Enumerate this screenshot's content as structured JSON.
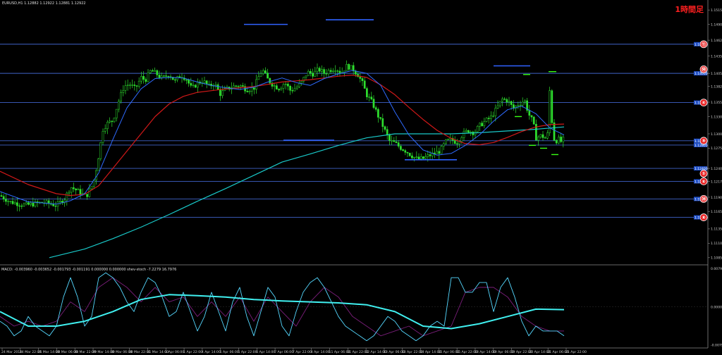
{
  "window": {
    "symbol_header": "EURUSD,H1  1.12882 1.12922 1.12881 1.12922",
    "timeframe_label": "1時間足",
    "macd_header": "MACD: -0.003960 -0.003652 -0.001793 -0.001191 0.000000 0.000000 shev-stoch -7.2279 16.7976"
  },
  "colors": {
    "background": "#000000",
    "grid": "#1f1f1f",
    "candle": "#2ee02e",
    "fast_ma": "#2f6bff",
    "mid_ma": "#d01818",
    "slow_ma": "#19c9c9",
    "hline": "#3f63c8",
    "horizontal_segment": "#2f62ff",
    "marker_segment": "#39ff14",
    "number_badge": "#e82020",
    "macd_fast": "#55d8ff",
    "macd_slow": "#7a1e7a",
    "macd_smooth": "#40f0f0"
  },
  "chart_data": [
    {
      "type": "line",
      "subtype": "candlestick",
      "symbol": "EURUSD",
      "timeframe": "H1",
      "y_tick_labels": [
        "1.15150",
        "1.14900",
        "1.14625",
        "1.14350",
        "1.14050",
        "1.13825",
        "1.13550",
        "1.13300",
        "1.13000",
        "1.12750",
        "1.12400",
        "1.12175",
        "1.11900",
        "1.11650",
        "1.11350",
        "1.11100",
        "1.10850"
      ],
      "y_tick_values": [
        1.1515,
        1.149,
        1.14625,
        1.1435,
        1.1405,
        1.13825,
        1.1355,
        1.133,
        1.13,
        1.1275,
        1.124,
        1.12175,
        1.119,
        1.1165,
        1.1135,
        1.111,
        1.1085
      ],
      "ylim": [
        1.1075,
        1.1525
      ],
      "x_tick_labels": [
        "24 Mar 2016",
        "24 Mar 22:00",
        "25 Mar 14:00",
        "28 Mar 06:00",
        "28 Mar 22:00",
        "29 Mar 14:00",
        "30 Mar 06:00",
        "30 Mar 22:00",
        "31 Mar 14:00",
        "1 Apr 06:00",
        "1 Apr 22:00",
        "4 Apr 14:00",
        "5 Apr 06:00",
        "5 Apr 22:00",
        "6 Apr 14:00",
        "7 Apr 06:00",
        "7 Apr 22:00",
        "8 Apr 14:00",
        "11 Apr 06:00",
        "11 Apr 22:00",
        "12 Apr 14:00",
        "13 Apr 06:00",
        "13 Apr 22:00",
        "14 Apr 14:00",
        "15 Apr 06:00",
        "15 Apr 22:00",
        "18 Apr 14:00",
        "19 Apr 06:00",
        "19 Apr 22:00",
        "20 Apr 14:00",
        "21 Apr 06:00",
        "21 Apr 22:00"
      ],
      "price_path_x": [
        0,
        14,
        36,
        62,
        80,
        92,
        100,
        110,
        122,
        132,
        138,
        146,
        152,
        160,
        168,
        176,
        184,
        192,
        200,
        206,
        214,
        222,
        230,
        240,
        248,
        256,
        264,
        272,
        280,
        288,
        296,
        304,
        312,
        320,
        330,
        340,
        350,
        360,
        366,
        372,
        380,
        388,
        396,
        404,
        412,
        420,
        428,
        436,
        444,
        452,
        460,
        468,
        476,
        484,
        492,
        500,
        508,
        514,
        520,
        528,
        536,
        544,
        552,
        560,
        568,
        576,
        584,
        592,
        600,
        608,
        616,
        624,
        632,
        640,
        648,
        656,
        664,
        672,
        680,
        688,
        696,
        704,
        712,
        720,
        728,
        736,
        744,
        750,
        756,
        760,
        768,
        776,
        780,
        784,
        788,
        792,
        796,
        800
      ],
      "price_path_y": [
        1.1193,
        1.1182,
        1.1176,
        1.1181,
        1.1176,
        1.1188,
        1.1208,
        1.1201,
        1.1191,
        1.1213,
        1.1248,
        1.1308,
        1.1318,
        1.1323,
        1.1356,
        1.1383,
        1.1386,
        1.1378,
        1.1398,
        1.1393,
        1.141,
        1.1404,
        1.1396,
        1.1404,
        1.1391,
        1.1402,
        1.1396,
        1.1378,
        1.1388,
        1.1392,
        1.1382,
        1.1388,
        1.1369,
        1.1377,
        1.1382,
        1.1384,
        1.1377,
        1.1379,
        1.1397,
        1.1411,
        1.1394,
        1.1384,
        1.1379,
        1.1389,
        1.1375,
        1.138,
        1.139,
        1.1407,
        1.1404,
        1.1412,
        1.1405,
        1.1411,
        1.1414,
        1.1406,
        1.1418,
        1.1413,
        1.1402,
        1.1388,
        1.1368,
        1.1354,
        1.1332,
        1.1311,
        1.1288,
        1.1284,
        1.1276,
        1.127,
        1.1262,
        1.1256,
        1.1257,
        1.1262,
        1.1266,
        1.127,
        1.1286,
        1.129,
        1.1285,
        1.1299,
        1.1306,
        1.1302,
        1.1314,
        1.1322,
        1.1328,
        1.1343,
        1.136,
        1.1358,
        1.1344,
        1.1352,
        1.1358,
        1.1334,
        1.1321,
        1.1293,
        1.1297,
        1.129,
        1.1384,
        1.1295,
        1.1287,
        1.1291,
        1.1286,
        1.1292
      ],
      "fast_ma": {
        "x": [
          0,
          40,
          80,
          100,
          120,
          140,
          160,
          180,
          200,
          220,
          240,
          260,
          280,
          300,
          320,
          340,
          360,
          380,
          400,
          420,
          440,
          460,
          480,
          500,
          520,
          540,
          560,
          580,
          600,
          620,
          640,
          660,
          680,
          700,
          720,
          740,
          760,
          780,
          800
        ],
        "y": [
          1.12,
          1.1182,
          1.1178,
          1.1184,
          1.1196,
          1.1232,
          1.129,
          1.1345,
          1.1378,
          1.1396,
          1.1398,
          1.1397,
          1.139,
          1.1384,
          1.138,
          1.1377,
          1.1381,
          1.139,
          1.1397,
          1.1389,
          1.1384,
          1.1396,
          1.1404,
          1.141,
          1.1405,
          1.1384,
          1.1338,
          1.1298,
          1.1272,
          1.1263,
          1.1266,
          1.128,
          1.1298,
          1.1322,
          1.1342,
          1.1348,
          1.1335,
          1.131,
          1.1298
        ]
      },
      "mid_ma": {
        "x": [
          0,
          40,
          80,
          100,
          120,
          140,
          160,
          180,
          200,
          220,
          240,
          260,
          280,
          300,
          320,
          340,
          360,
          380,
          400,
          420,
          440,
          460,
          480,
          500,
          520,
          540,
          560,
          580,
          600,
          620,
          640,
          660,
          680,
          700,
          720,
          740,
          760,
          780,
          800
        ],
        "y": [
          1.1235,
          1.1212,
          1.1196,
          1.1193,
          1.1195,
          1.121,
          1.124,
          1.127,
          1.13,
          1.133,
          1.1352,
          1.1365,
          1.1372,
          1.1375,
          1.1378,
          1.138,
          1.1382,
          1.1386,
          1.139,
          1.1392,
          1.1394,
          1.1397,
          1.14,
          1.1402,
          1.1398,
          1.1385,
          1.1368,
          1.1346,
          1.1325,
          1.1306,
          1.1292,
          1.1283,
          1.1281,
          1.1285,
          1.1294,
          1.1304,
          1.1312,
          1.1316,
          1.1317
        ]
      },
      "slow_ma": {
        "x": [
          70,
          120,
          160,
          200,
          240,
          280,
          320,
          360,
          400,
          440,
          480,
          520,
          560,
          600,
          640,
          680,
          720,
          760,
          800
        ],
        "y": [
          1.1085,
          1.11,
          1.1118,
          1.1138,
          1.116,
          1.1183,
          1.1205,
          1.1228,
          1.1251,
          1.1265,
          1.128,
          1.1293,
          1.13,
          1.13,
          1.13,
          1.1302,
          1.1305,
          1.1308,
          1.1312
        ]
      },
      "horizontal_lines": [
        1.14556,
        1.1405,
        1.13543,
        1.1288,
        1.12805,
        1.124,
        1.12175,
        1.1187,
        1.1155
      ],
      "line_labels": [
        "1.14556",
        "1.14050",
        "1.13543",
        "1.12880",
        "1.12805",
        "1.12400",
        "1.12175",
        "1.11870",
        "1.11550"
      ],
      "number_badges": [
        {
          "label": "⑪",
          "value": 1.14556
        },
        {
          "label": "㊿",
          "value": 1.1412
        },
        {
          "label": "④",
          "value": 1.13543
        },
        {
          "label": "⑨",
          "value": 1.1288
        },
        {
          "label": "⑤",
          "value": 1.1231
        },
        {
          "label": "⑥",
          "value": 1.12175
        },
        {
          "label": "㉞",
          "value": 1.1187
        },
        {
          "label": "⑧",
          "value": 1.1155
        }
      ],
      "horizontal_segments": [
        {
          "x0": 346,
          "x1": 408,
          "y": 1.149
        },
        {
          "x0": 462,
          "x1": 530,
          "y": 1.1498
        },
        {
          "x0": 402,
          "x1": 474,
          "y": 1.1289
        },
        {
          "x0": 574,
          "x1": 648,
          "y": 1.1255
        },
        {
          "x0": 700,
          "x1": 752,
          "y": 1.1418
        }
      ],
      "marker_segments": [
        {
          "x0": 742,
          "x1": 752,
          "y": 1.1403
        },
        {
          "x0": 730,
          "x1": 740,
          "y": 1.133
        },
        {
          "x0": 778,
          "x1": 789,
          "y": 1.1408
        },
        {
          "x0": 750,
          "x1": 760,
          "y": 1.128
        },
        {
          "x0": 766,
          "x1": 776,
          "y": 1.1275
        },
        {
          "x0": 782,
          "x1": 792,
          "y": 1.1264
        }
      ]
    },
    {
      "type": "line",
      "name": "MACD",
      "y_tick_labels": [
        "0.007910",
        "0.000000",
        "-0.007910"
      ],
      "y_tick_values": [
        0.00791,
        0.0,
        -0.00791
      ],
      "ylim": [
        -0.0085,
        0.0085
      ],
      "fast_osc": {
        "x": [
          0,
          10,
          20,
          30,
          40,
          50,
          60,
          70,
          80,
          90,
          100,
          110,
          120,
          130,
          140,
          150,
          160,
          170,
          180,
          190,
          200,
          210,
          220,
          230,
          240,
          250,
          260,
          270,
          280,
          290,
          300,
          310,
          320,
          330,
          340,
          350,
          360,
          370,
          380,
          390,
          400,
          410,
          420,
          430,
          440,
          450,
          460,
          470,
          480,
          490,
          500,
          510,
          520,
          530,
          540,
          550,
          560,
          570,
          580,
          590,
          600,
          610,
          620,
          630,
          640,
          650,
          660,
          670,
          680,
          690,
          700,
          710,
          720,
          730,
          740,
          750,
          760,
          770,
          780,
          790,
          800
        ],
        "y": [
          -0.003,
          -0.004,
          -0.006,
          -0.005,
          -0.002,
          -0.004,
          -0.005,
          -0.006,
          -0.004,
          0.002,
          0.006,
          0.002,
          -0.004,
          -0.002,
          0.006,
          0.007,
          0.006,
          0.004,
          0.001,
          -0.001,
          0.003,
          0.006,
          0.005,
          0.002,
          -0.002,
          -0.001,
          0.003,
          -0.001,
          -0.005,
          -0.002,
          0.003,
          -0.001,
          -0.005,
          0.001,
          0.004,
          -0.002,
          -0.006,
          -0.001,
          0.004,
          0.002,
          -0.004,
          -0.006,
          -0.001,
          0.003,
          0.005,
          0.006,
          0.004,
          0.001,
          -0.002,
          -0.004,
          -0.005,
          -0.006,
          -0.007,
          -0.006,
          -0.004,
          -0.002,
          -0.003,
          -0.005,
          -0.006,
          -0.007,
          -0.006,
          -0.004,
          -0.003,
          -0.004,
          0.006,
          0.006,
          0.003,
          0.003,
          0.005,
          0.005,
          -0.001,
          0.004,
          0.006,
          0.002,
          -0.003,
          -0.006,
          -0.004,
          -0.005,
          -0.005,
          -0.005,
          -0.006
        ]
      },
      "slow_osc": {
        "x": [
          0,
          20,
          40,
          60,
          80,
          100,
          120,
          140,
          160,
          180,
          200,
          220,
          240,
          260,
          280,
          300,
          320,
          340,
          360,
          380,
          400,
          420,
          440,
          460,
          480,
          500,
          520,
          540,
          560,
          580,
          600,
          620,
          640,
          660,
          680,
          700,
          720,
          740,
          760,
          780,
          800
        ],
        "y": [
          -0.002,
          -0.004,
          -0.003,
          -0.004,
          -0.003,
          0.001,
          -0.001,
          0.004,
          0.006,
          0.004,
          0.001,
          0.004,
          0.001,
          0.002,
          -0.002,
          0.001,
          -0.002,
          0.002,
          -0.003,
          0.002,
          -0.001,
          -0.004,
          0.001,
          0.004,
          0.002,
          -0.002,
          -0.004,
          -0.006,
          -0.005,
          -0.004,
          -0.006,
          -0.005,
          -0.004,
          0.003,
          0.004,
          0.004,
          0.002,
          -0.002,
          -0.004,
          -0.005,
          -0.005
        ]
      },
      "smooth": {
        "x": [
          0,
          40,
          80,
          120,
          160,
          200,
          240,
          280,
          320,
          360,
          400,
          440,
          480,
          520,
          560,
          600,
          640,
          680,
          720,
          760,
          800
        ],
        "y": [
          -0.001,
          -0.004,
          -0.004,
          -0.003,
          -0.001,
          0.0015,
          0.0025,
          0.0023,
          0.002,
          0.0015,
          0.0012,
          0.001,
          0.0008,
          0.0004,
          -0.001,
          -0.004,
          -0.0045,
          -0.0035,
          -0.002,
          -0.0005,
          -0.0006
        ]
      }
    }
  ]
}
